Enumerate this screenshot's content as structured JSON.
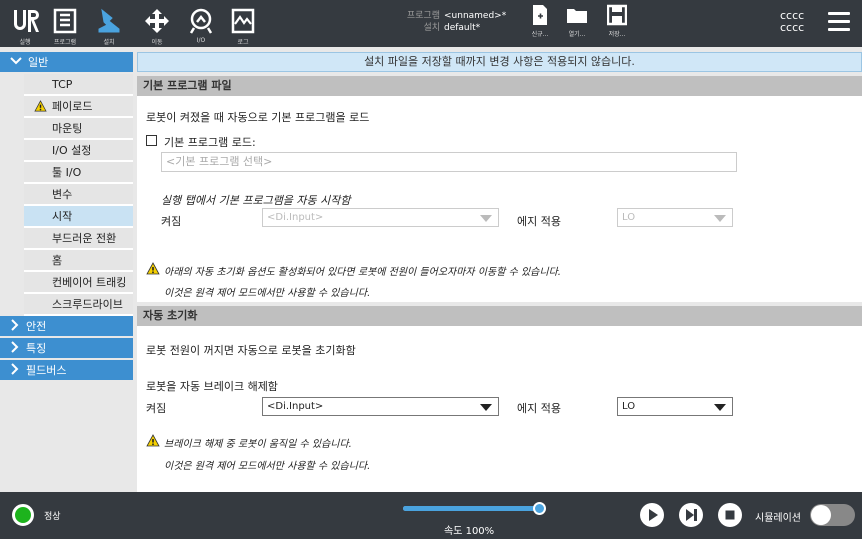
{
  "topbar": {
    "nav": [
      {
        "label": "실행",
        "icon": "ur-logo-icon"
      },
      {
        "label": "프로그램",
        "icon": "program-icon"
      },
      {
        "label": "설치",
        "icon": "installation-icon"
      },
      {
        "label": "이동",
        "icon": "move-icon"
      },
      {
        "label": "I/O",
        "icon": "io-icon"
      },
      {
        "label": "로그",
        "icon": "log-icon"
      }
    ],
    "program_key": "프로그램",
    "program_value": "<unnamed>*",
    "install_key": "설치",
    "install_value": "default*",
    "file_buttons": [
      {
        "label": "신규...",
        "icon": "new-file-icon"
      },
      {
        "label": "열기...",
        "icon": "open-folder-icon"
      },
      {
        "label": "저장...",
        "icon": "save-icon"
      }
    ],
    "user_line1": "cccc",
    "user_line2": "cccc"
  },
  "sidebar": {
    "general": "일반",
    "items": [
      {
        "label": "TCP"
      },
      {
        "label": "페이로드",
        "warning": true
      },
      {
        "label": "마운팅"
      },
      {
        "label": "I/O 설정"
      },
      {
        "label": "툴 I/O"
      },
      {
        "label": "변수"
      },
      {
        "label": "시작",
        "selected": true
      },
      {
        "label": "부드러운 전환"
      },
      {
        "label": "홈"
      },
      {
        "label": "컨베이어 트래킹"
      },
      {
        "label": "스크루드라이브"
      }
    ],
    "safety": "안전",
    "features": "특징",
    "fieldbus": "필드버스"
  },
  "main": {
    "banner": "설치 파일을 저장할 때까지 변경 사항은 적용되지 않습니다.",
    "section1_title": "기본 프로그램 파일",
    "auto_load_text": "로봇이 켜졌을 때 자동으로 기본 프로그램을 로드",
    "load_checkbox_label": "기본 프로그램 로드:",
    "program_placeholder": "<기본 프로그램 선택>",
    "auto_start_text": "실행 탭에서 기본 프로그램을 자동 시작함",
    "on_label1": "켜짐",
    "input_select1": "<Di.Input>",
    "edge_label1": "에지 적용",
    "edge_select1": "LO",
    "warning1_line1": "아래의 자동 초기화 옵션도 활성화되어 있다면 로봇에 전원이 들어오자마자 이동할 수 있습니다.",
    "warning1_line2": "이것은 원격 제어 모드에서만 사용할 수 있습니다.",
    "section2_title": "자동 초기화",
    "auto_init_text": "로봇 전원이 꺼지면 자동으로 로봇을 초기화함",
    "brake_text": "로봇을 자동 브레이크 해제함",
    "on_label2": "켜짐",
    "input_select2": "<Di.Input>",
    "edge_label2": "에지 적용",
    "edge_select2": "LO",
    "warning2_line1": "브레이크 해제 중 로봇이 움직일 수 있습니다.",
    "warning2_line2": "이것은 원격 제어 모드에서만 사용할 수 있습니다."
  },
  "bottombar": {
    "status": "정상",
    "speed_label": "속도 100%",
    "speed_fraction": 1.0,
    "simulation_label": "시뮬레이션",
    "status_color": "#1db31d",
    "accent_color": "#4aa3df"
  }
}
